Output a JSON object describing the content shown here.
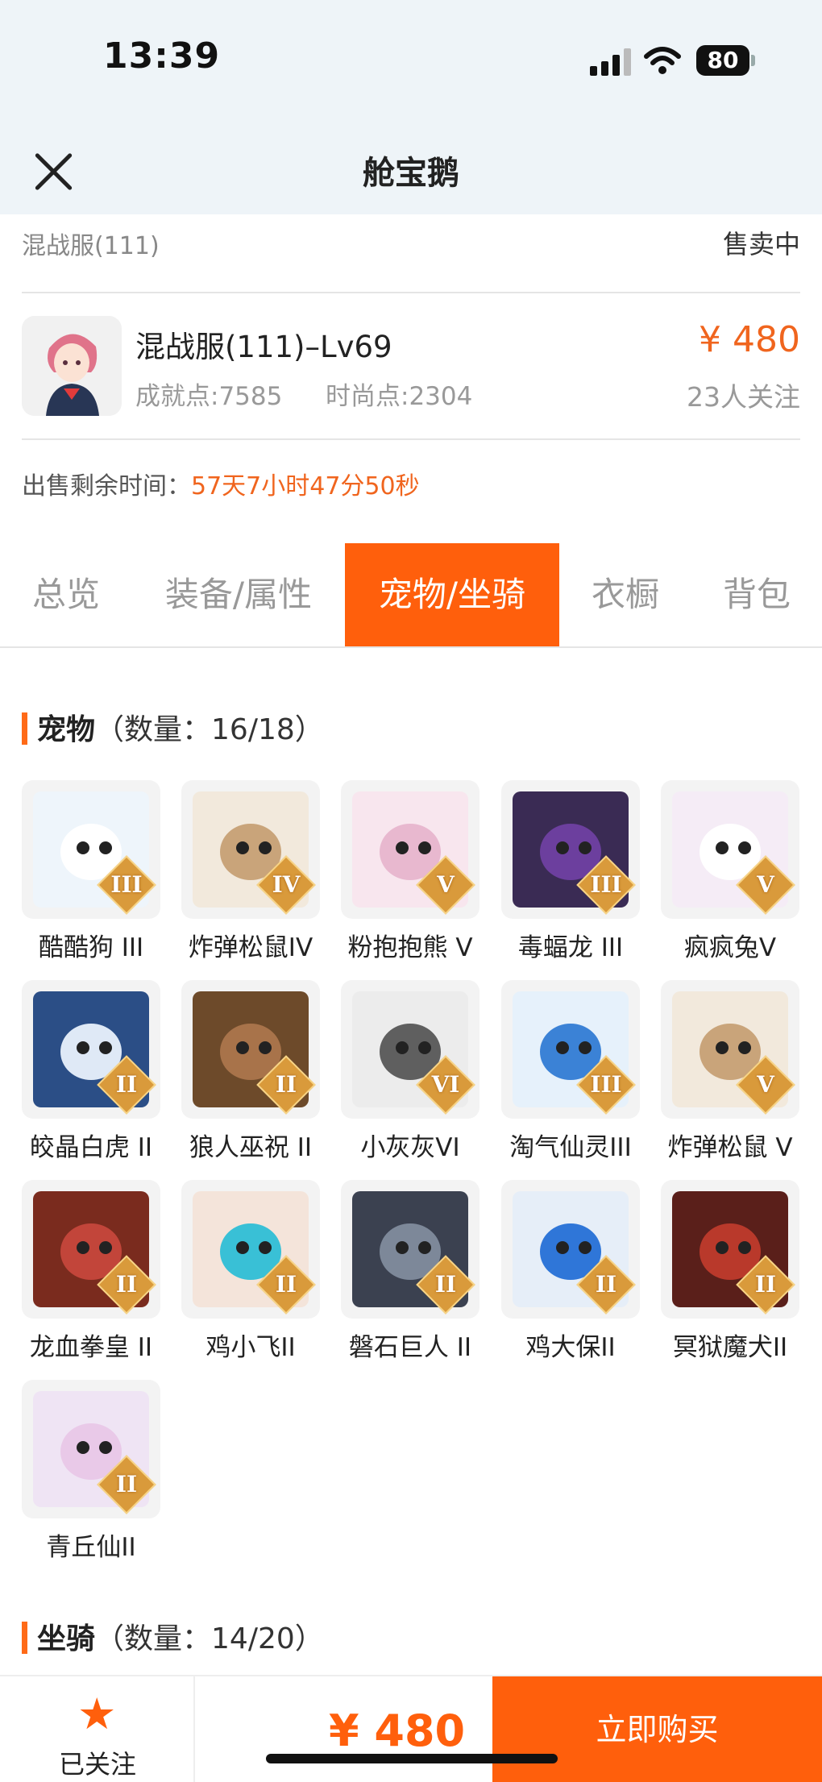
{
  "status_bar": {
    "time": "13:39",
    "battery": "80"
  },
  "nav": {
    "title": "舱宝鹅"
  },
  "server": {
    "name": "混战服(111)",
    "status": "售卖中"
  },
  "listing": {
    "title": "混战服(111)–Lv69",
    "achievement": "成就点:7585",
    "fashion": "时尚点:2304",
    "price": "¥ 480",
    "followers": "23人关注"
  },
  "remaining": {
    "label": "出售剩余时间：",
    "value": "57天7小时47分50秒"
  },
  "tabs": [
    {
      "label": "总览"
    },
    {
      "label": "装备/属性"
    },
    {
      "label": "宠物/坐骑",
      "active": true
    },
    {
      "label": "衣橱"
    },
    {
      "label": "背包"
    }
  ],
  "pets_section": {
    "title": "宠物",
    "count": "（数量：16/18）"
  },
  "pets": [
    {
      "name": "酷酷狗 III",
      "tier": "III",
      "icon": "cool-dog-icon",
      "bg": "#eef5fb",
      "face": "#ffffff"
    },
    {
      "name": "炸弹松鼠IV",
      "tier": "IV",
      "icon": "bomb-squirrel-icon",
      "bg": "#f2e9dc",
      "face": "#c9a47a"
    },
    {
      "name": "粉抱抱熊 V",
      "tier": "V",
      "icon": "pink-bear-icon",
      "bg": "#f8e6ee",
      "face": "#e8b8cf"
    },
    {
      "name": "毒蝠龙 III",
      "tier": "III",
      "icon": "poison-bat-dragon-icon",
      "bg": "#3a2b54",
      "face": "#6c3f9e"
    },
    {
      "name": "疯疯兔V",
      "tier": "V",
      "icon": "crazy-rabbit-icon",
      "bg": "#f5ecf6",
      "face": "#ffffff"
    },
    {
      "name": "皎晶白虎 II",
      "tier": "II",
      "icon": "white-tiger-icon",
      "bg": "#2b4e86",
      "face": "#dfe9f6"
    },
    {
      "name": "狼人巫祝 II",
      "tier": "II",
      "icon": "werewolf-shaman-icon",
      "bg": "#6d4a2a",
      "face": "#a8734a"
    },
    {
      "name": "小灰灰VI",
      "tier": "VI",
      "icon": "little-grey-wolf-icon",
      "bg": "#ececec",
      "face": "#5f5f5f"
    },
    {
      "name": "淘气仙灵III",
      "tier": "III",
      "icon": "naughty-sprite-icon",
      "bg": "#e6f1fb",
      "face": "#3b82d6"
    },
    {
      "name": "炸弹松鼠 V",
      "tier": "V",
      "icon": "bomb-squirrel-icon",
      "bg": "#f2e9dc",
      "face": "#c9a47a"
    },
    {
      "name": "龙血拳皇 II",
      "tier": "II",
      "icon": "dragon-blood-boxer-icon",
      "bg": "#7a2b1e",
      "face": "#c2453a"
    },
    {
      "name": "鸡小飞II",
      "tier": "II",
      "icon": "chick-fly-icon",
      "bg": "#f4e4da",
      "face": "#39c0d6"
    },
    {
      "name": "磐石巨人 II",
      "tier": "II",
      "icon": "rock-giant-icon",
      "bg": "#3b4150",
      "face": "#7d8899"
    },
    {
      "name": "鸡大保II",
      "tier": "II",
      "icon": "chicken-boss-icon",
      "bg": "#e6eef8",
      "face": "#2f76d8"
    },
    {
      "name": "冥狱魔犬II",
      "tier": "II",
      "icon": "hell-hound-icon",
      "bg": "#5a1f1a",
      "face": "#b9392b"
    },
    {
      "name": "青丘仙II",
      "tier": "II",
      "icon": "fox-fairy-icon",
      "bg": "#efe4f4",
      "face": "#e9c9e8"
    }
  ],
  "mounts_section": {
    "title": "坐骑",
    "count": "（数量：14/20）"
  },
  "bottom_bar": {
    "follow_label": "已关注",
    "price": "¥ 480",
    "buy_label": "立即购买"
  },
  "colors": {
    "accent": "#ff5f0c",
    "price": "#f0651e"
  }
}
